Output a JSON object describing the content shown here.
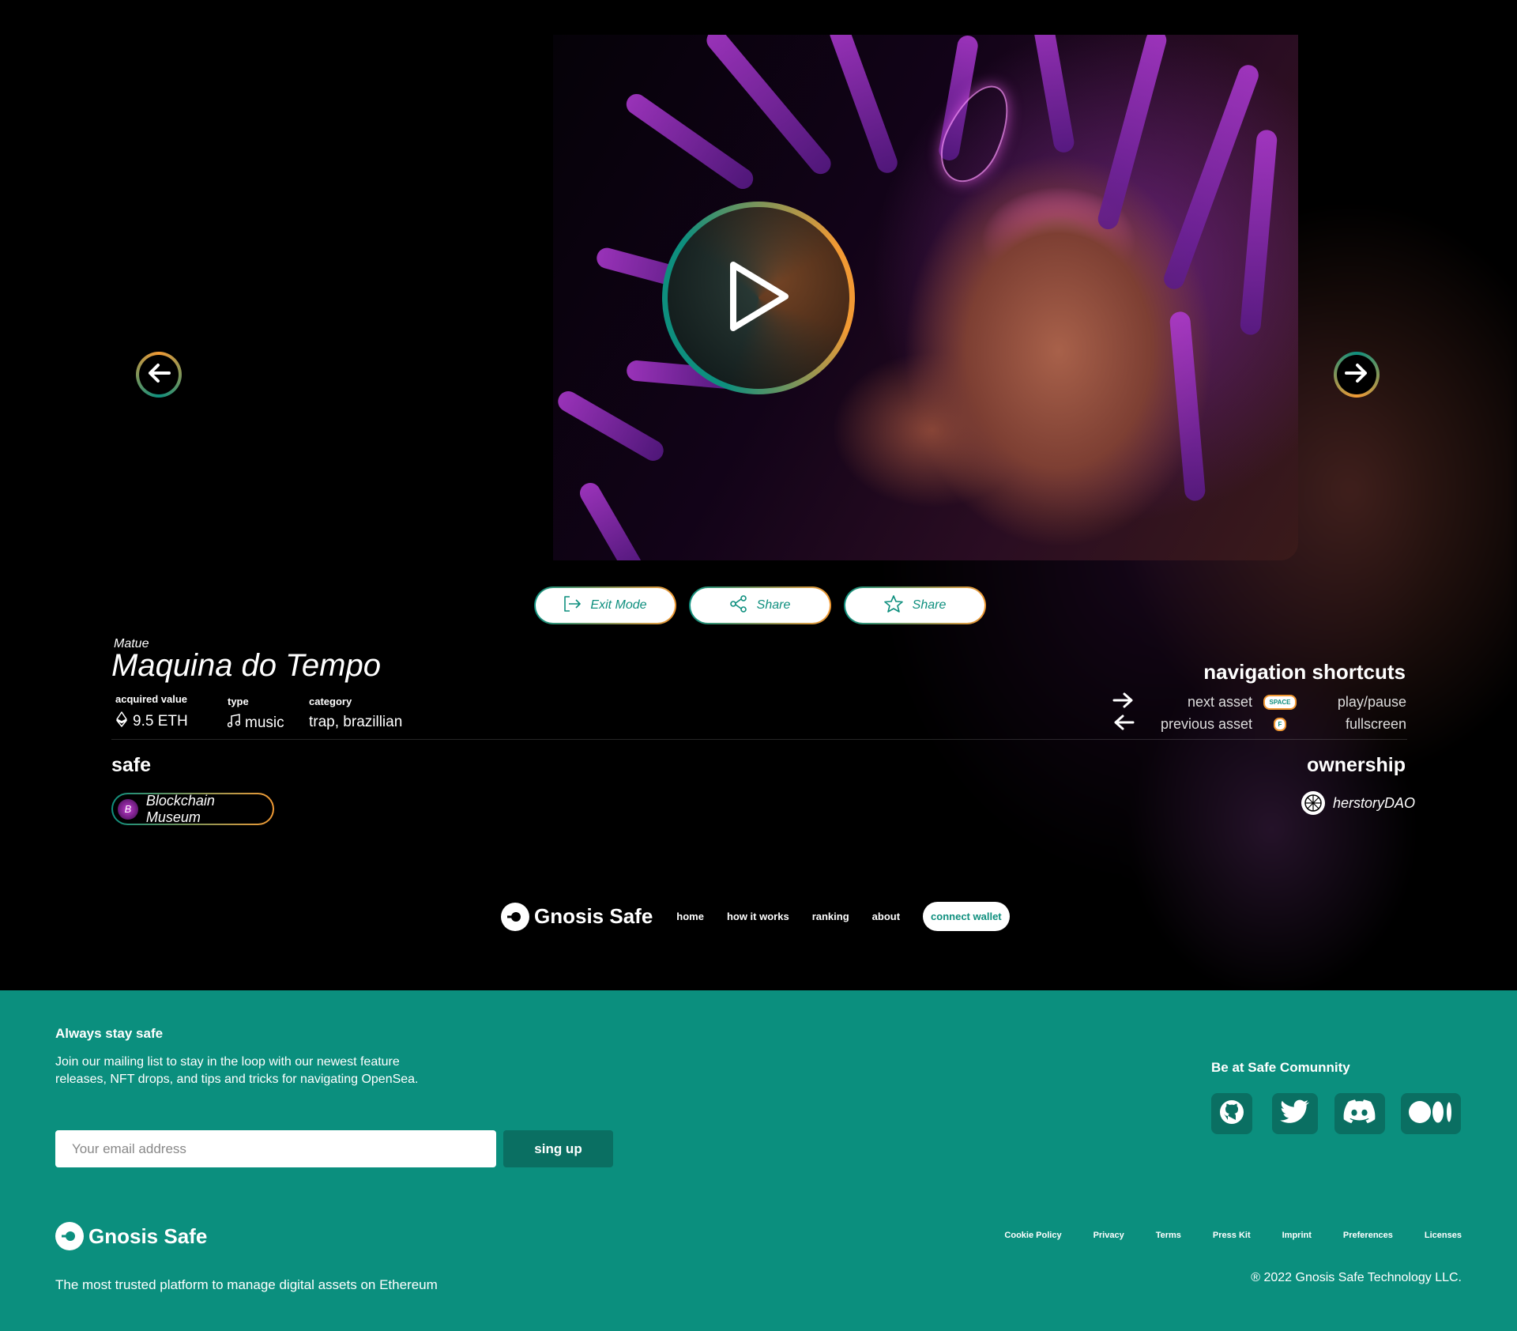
{
  "player": {
    "play_icon": "play-icon",
    "prev_icon": "arrow-left-icon",
    "next_icon": "arrow-right-icon"
  },
  "actions": [
    {
      "label": "Exit Mode",
      "icon": "exit-icon"
    },
    {
      "label": "Share",
      "icon": "share-icon"
    },
    {
      "label": "Share",
      "icon": "star-icon"
    }
  ],
  "asset": {
    "artist": "Matue",
    "title": "Maquina do Tempo",
    "acquired_label": "acquired value",
    "acquired_value": "9.5 ETH",
    "type_label": "type",
    "type_value": "music",
    "category_label": "category",
    "category_value": "trap, brazillian"
  },
  "shortcuts": {
    "title": "navigation shortcuts",
    "next": "next asset",
    "previous": "previous asset",
    "space_key": "SPACE",
    "f_key": "F",
    "play_pause": "play/pause",
    "fullscreen": "fullscreen"
  },
  "safe": {
    "title": "safe",
    "chip_label": "Blockchain Museum",
    "chip_avatar": "B"
  },
  "ownership": {
    "title": "ownership",
    "owner": "herstoryDAO"
  },
  "nav": {
    "brand": "Gnosis Safe",
    "links": [
      "home",
      "how it works",
      "ranking",
      "about"
    ],
    "connect": "connect wallet"
  },
  "footer": {
    "heading": "Always stay safe",
    "text": "Join our mailing list to stay in the loop with our newest feature releases, NFT drops, and tips and tricks for navigating OpenSea.",
    "email_placeholder": "Your email address",
    "signup": "sing up",
    "community": "Be at Safe Comunnity",
    "socials": [
      "github-icon",
      "twitter-icon",
      "discord-icon",
      "medium-icon"
    ],
    "brand": "Gnosis Safe",
    "tagline": "The most trusted platform to manage digital assets on Ethereum",
    "links": [
      "Cookie Policy",
      "Privacy",
      "Terms",
      "Press Kit",
      "Imprint",
      "Preferences",
      "Licenses"
    ],
    "copyright": "® 2022 Gnosis Safe Technology LLC."
  },
  "colors": {
    "teal": "#0b8f7e",
    "orange": "#f29a34",
    "dark_teal": "#0a6f62"
  }
}
